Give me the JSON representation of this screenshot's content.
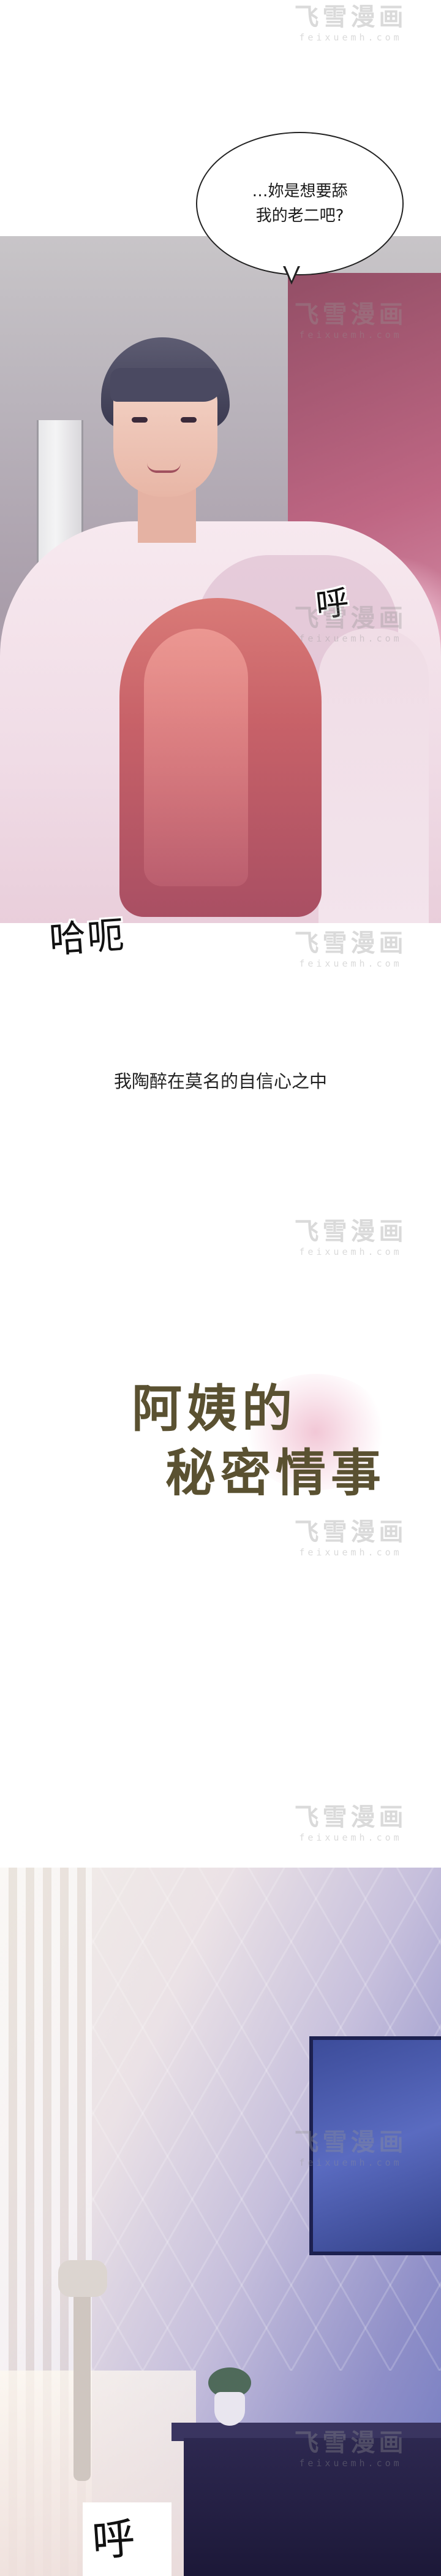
{
  "watermark": {
    "title": "飞雪漫画",
    "site": "feixuemh.com"
  },
  "panel1": {
    "speech": [
      "…妳是想要舔",
      "我的老二吧?"
    ],
    "sfx_breath": "呼",
    "sfx_gasp": "哈呃"
  },
  "narration": "我陶醉在莫名的自信心之中",
  "title_logo": {
    "line1": "阿姨的",
    "line2": "秘密情事"
  },
  "panel2": {
    "sfx_breath": "呼"
  },
  "colors": {
    "text": "#1a1a1a",
    "title": "#5a5131",
    "watermark": "#969696"
  }
}
